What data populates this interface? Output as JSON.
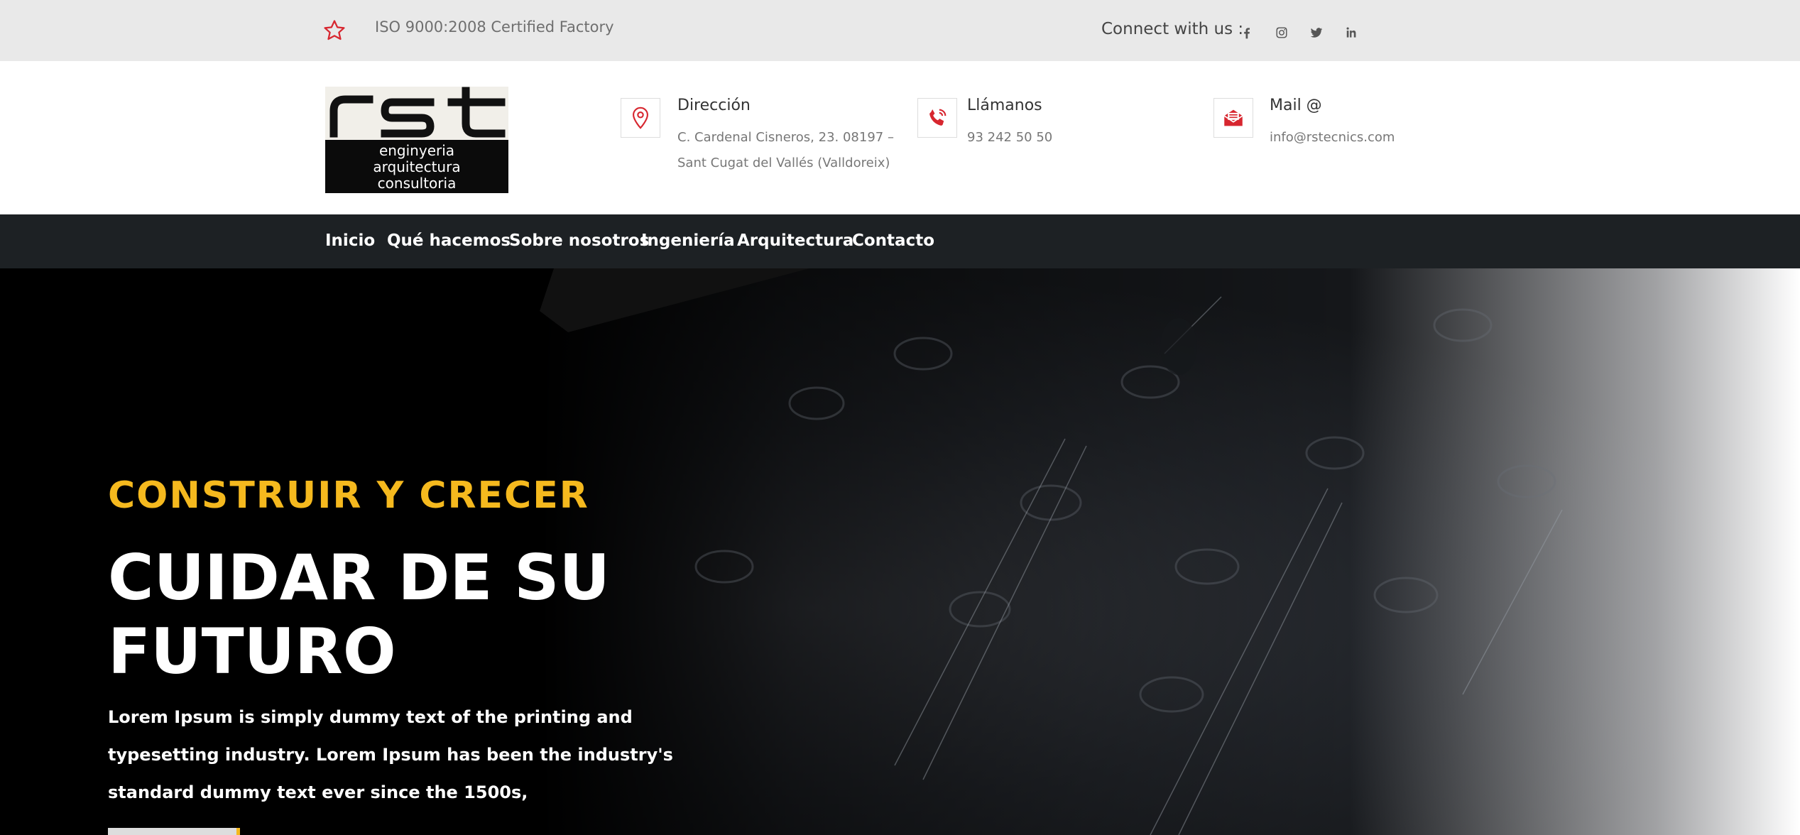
{
  "topbar": {
    "iso_text": "ISO 9000:2008 Certified Factory",
    "connect_label": "Connect with us :",
    "social": [
      "facebook-icon",
      "instagram-icon",
      "twitter-icon",
      "linkedin-icon"
    ]
  },
  "logo": {
    "main": "rst",
    "line1": "enginyeria",
    "line2": "arquitectura",
    "line3": "consultoria"
  },
  "contact": {
    "address": {
      "title": "Dirección",
      "line1": "C. Cardenal Cisneros, 23. 08197 –",
      "line2": "Sant Cugat del Vallés (Valldoreix)"
    },
    "phone": {
      "title": "Llámanos",
      "value": "93 242 50 50"
    },
    "mail": {
      "title": "Mail @",
      "value": "info@rstecnics.com"
    }
  },
  "nav": [
    "Inicio",
    "Qué hacemos",
    "Sobre nosotros",
    "Ingeniería",
    "Arquitectura",
    "Contacto"
  ],
  "hero": {
    "subtitle": "CONSTRUIR Y CRECER",
    "title": "CUIDAR DE SU FUTURO",
    "desc": "Lorem Ipsum is simply dummy text of the printing and typesetting industry. Lorem Ipsum has been the industry's standard dummy text ever since the 1500s,"
  },
  "colors": {
    "accent": "#f5b91e",
    "icon_red": "#d7262f",
    "nav_bg": "#1d2124",
    "topbar_bg": "#e9e9e9"
  }
}
